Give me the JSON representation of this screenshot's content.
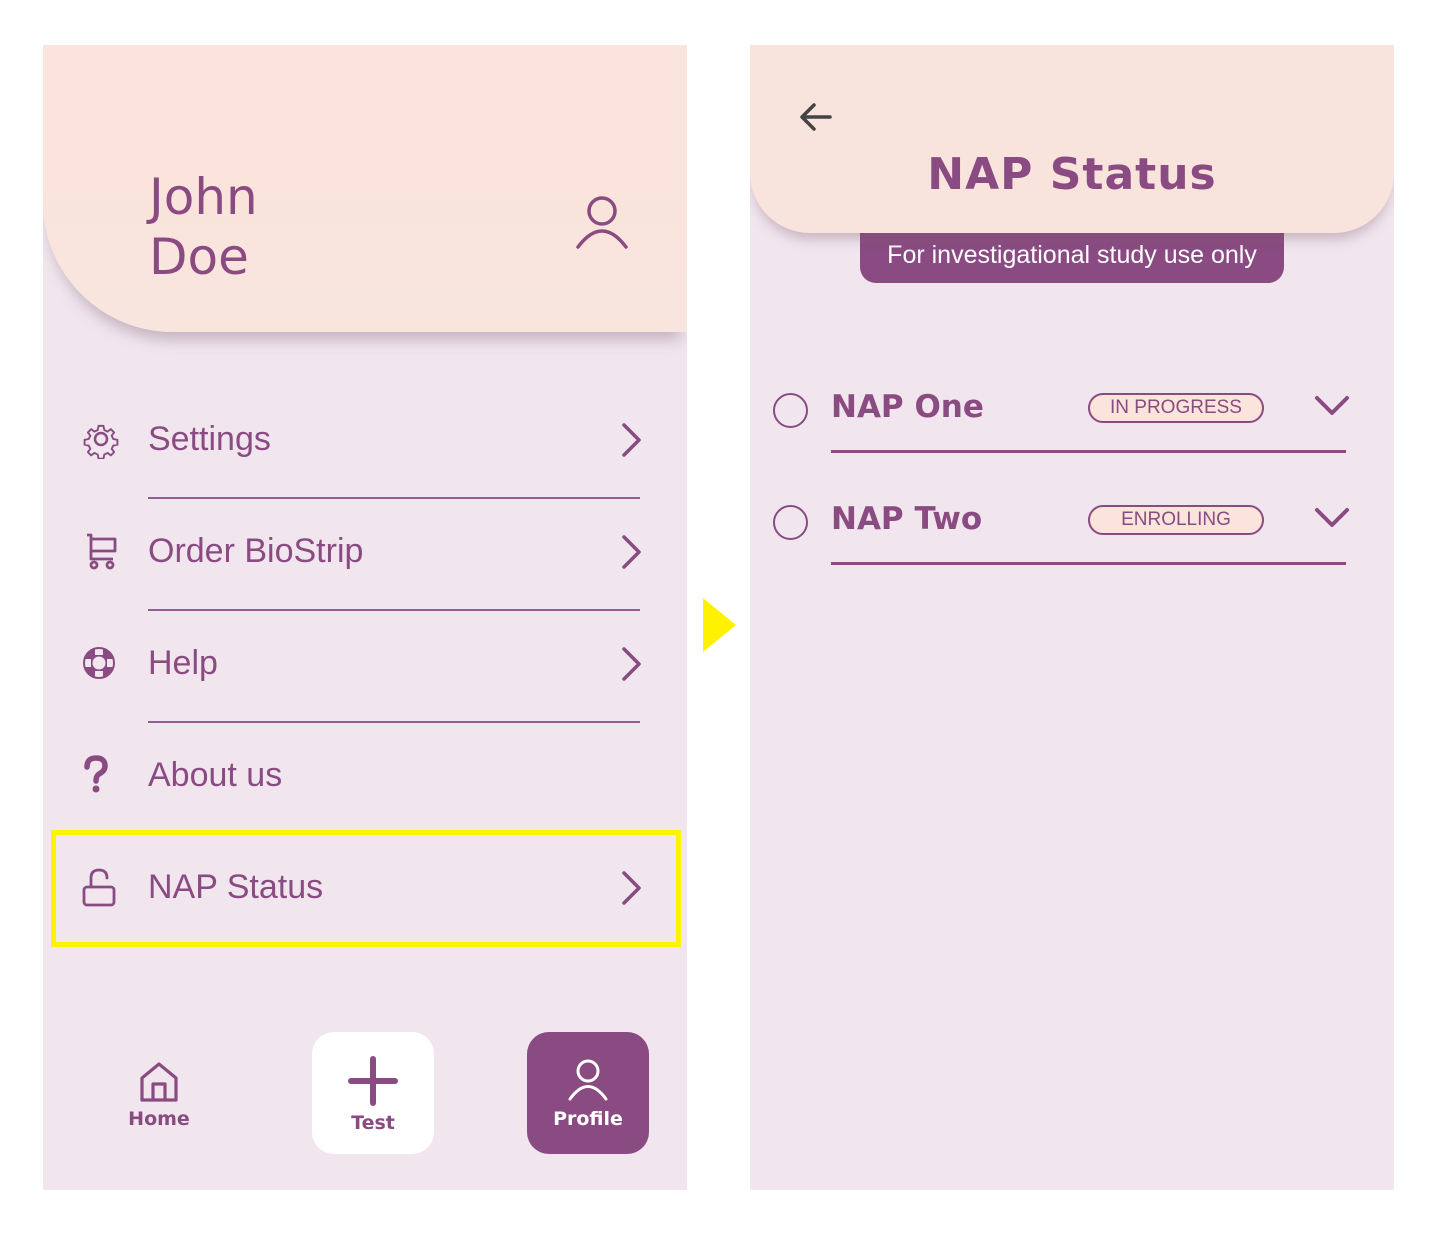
{
  "profile_screen": {
    "user_name": "John\nDoe",
    "menu": [
      {
        "label": "Settings",
        "icon": "gear-icon",
        "has_chevron": true
      },
      {
        "label": "Order BioStrip",
        "icon": "cart-icon",
        "has_chevron": true
      },
      {
        "label": "Help",
        "icon": "lifebuoy-icon",
        "has_chevron": true
      },
      {
        "label": "About us",
        "icon": "question-icon",
        "has_chevron": false
      },
      {
        "label": "NAP Status",
        "icon": "unlock-icon",
        "has_chevron": true,
        "highlighted": true
      }
    ],
    "bottom_nav": {
      "home": "Home",
      "test": "Test",
      "profile": "Profile",
      "active": "profile"
    }
  },
  "nap_status_screen": {
    "title": "NAP Status",
    "banner": "For investigational study use only",
    "naps": [
      {
        "name": "NAP One",
        "status": "IN PROGRESS"
      },
      {
        "name": "NAP Two",
        "status": "ENROLLING"
      }
    ]
  },
  "colors": {
    "brand_purple": "#8a4b82",
    "header_peach": "#f8e4dc",
    "background": "#f1e6ee",
    "highlight_yellow": "#fff200"
  }
}
